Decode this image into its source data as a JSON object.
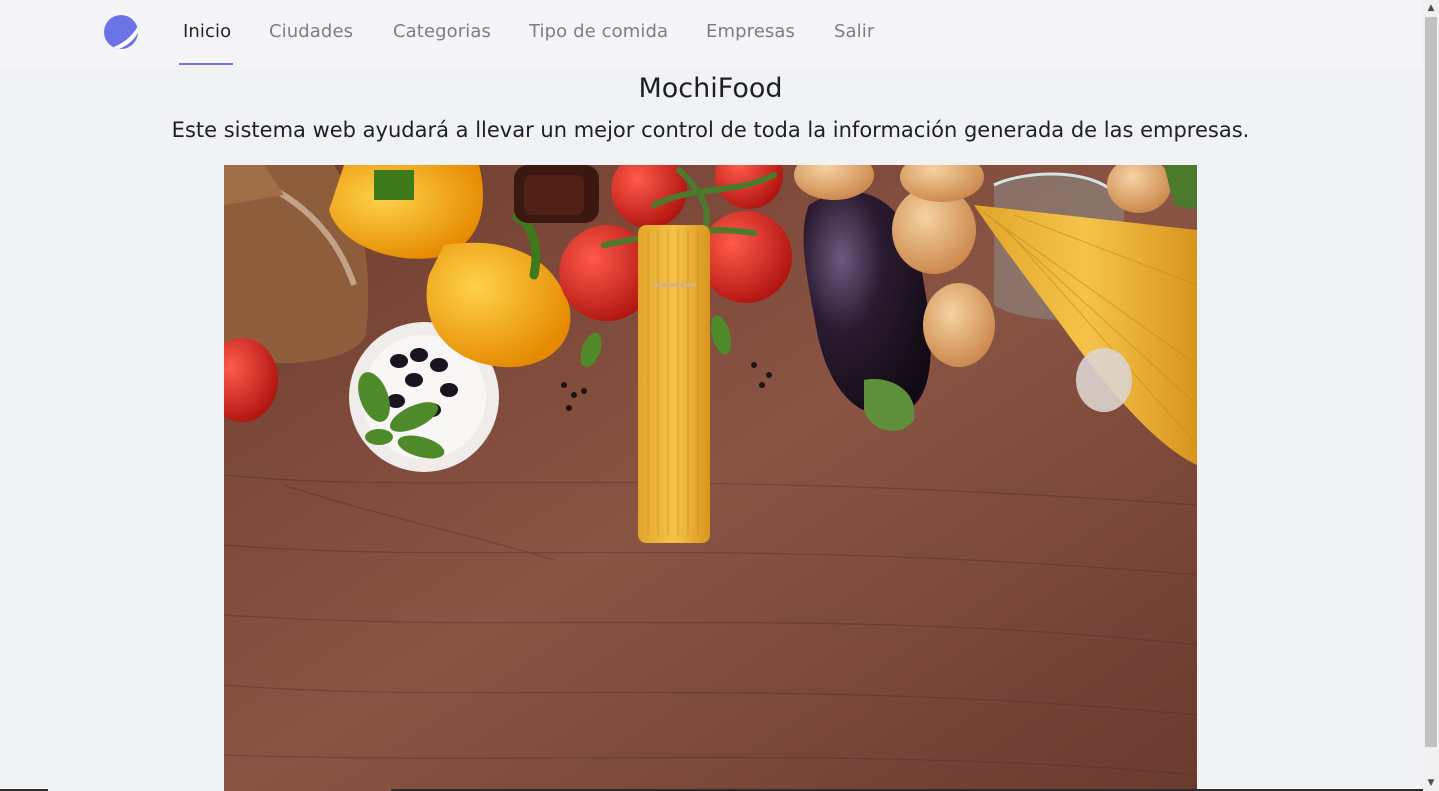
{
  "nav": {
    "logo_icon": "half-moon-logo-icon",
    "items": [
      {
        "label": "Inicio",
        "active": true
      },
      {
        "label": "Ciudades",
        "active": false
      },
      {
        "label": "Categorias",
        "active": false
      },
      {
        "label": "Tipo de comida",
        "active": false
      },
      {
        "label": "Empresas",
        "active": false
      },
      {
        "label": "Salir",
        "active": false
      }
    ]
  },
  "main": {
    "title": "MochiFood",
    "subtitle": "Este sistema web ayudará a llevar un mejor control de toda la información generada de las empresas."
  },
  "colors": {
    "accent": "#6f77e8",
    "nav_text": "#7a7f86",
    "nav_active_text": "#1f2329",
    "background": "#f1f2f4",
    "wood": "#7b4636"
  }
}
